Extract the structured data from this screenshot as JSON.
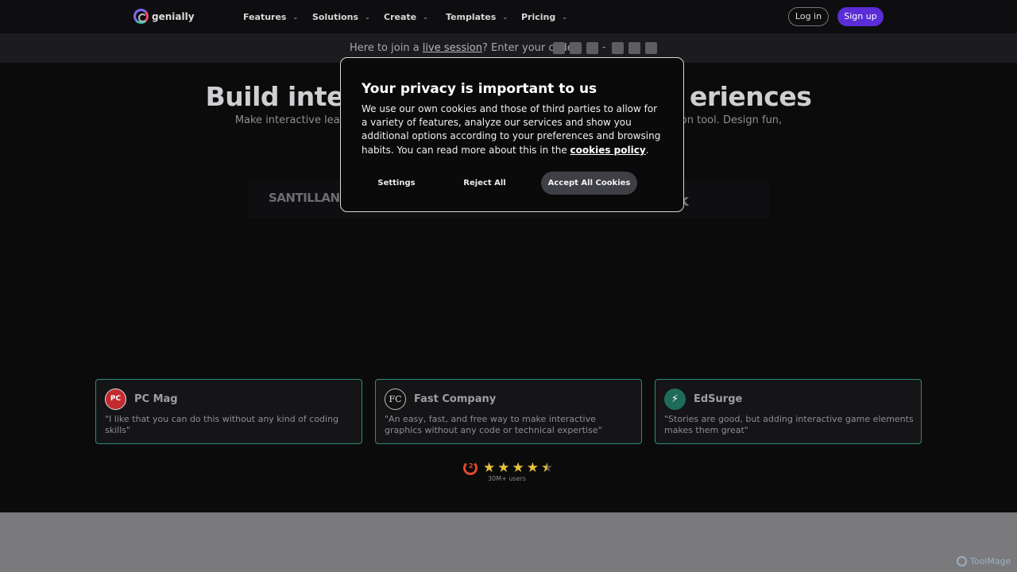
{
  "brand": {
    "name": "genially"
  },
  "nav": {
    "items": [
      {
        "label": "Features"
      },
      {
        "label": "Solutions"
      },
      {
        "label": "Create"
      },
      {
        "label": "Templates"
      },
      {
        "label": "Pricing"
      }
    ],
    "login_label": "Log in",
    "signup_label": "Sign up"
  },
  "live_bar": {
    "prefix": "Here to join a ",
    "link": "live session",
    "suffix": "? Enter your code",
    "code_boxes": 6
  },
  "hero": {
    "title_left": "Build inte",
    "title_right": "eriences",
    "sub_left": "Make interactive lear",
    "sub_right": "tion tool. Design fun,"
  },
  "brand_strip": {
    "left": "SANTILLANA",
    "right": "ok"
  },
  "cookie_modal": {
    "title": "Your privacy is important to us",
    "body": "We use our own cookies and those of third parties to allow for a variety of features, analyze our services and show you additional options according to your preferences and browsing habits. You can read more about this in the ",
    "policy_link": "cookies policy",
    "body_end": ".",
    "settings_label": "Settings",
    "reject_label": "Reject All",
    "accept_label": "Accept All Cookies"
  },
  "press": [
    {
      "name": "PC Mag",
      "icon": "PC",
      "quote": "\"I like that you can do this without any kind of coding skills\""
    },
    {
      "name": "Fast Company",
      "icon": "FC",
      "quote": "\"An easy, fast, and free way to make interactive graphics without any code or technical expertise\""
    },
    {
      "name": "EdSurge",
      "icon": "⚡",
      "quote": "\"Stories are good, but adding interactive game elements makes them great\""
    }
  ],
  "rating": {
    "stars": 4.5,
    "users_label": "30M+ users",
    "g2_label": "2"
  },
  "watermark": {
    "label": "ToolMage"
  },
  "colors": {
    "accent": "#5a2dd6",
    "card_border": "#2e8d73",
    "star": "#e7c13f",
    "g2": "#e4492f"
  }
}
